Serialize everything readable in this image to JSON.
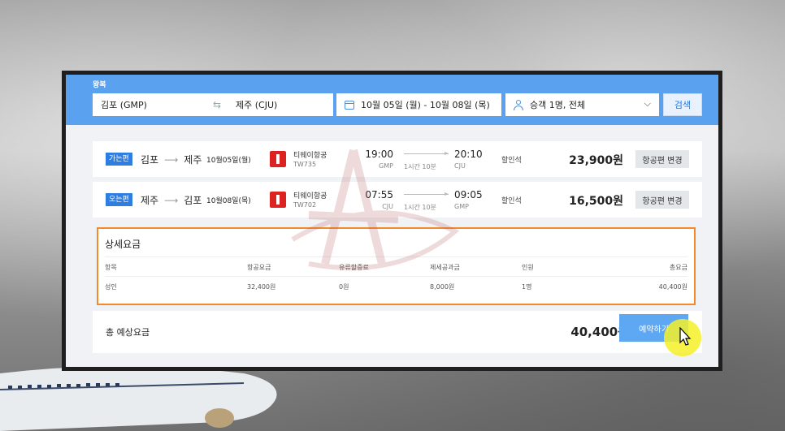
{
  "search": {
    "trip_type": "왕복",
    "origin": "김포 (GMP)",
    "destination": "제주 (CJU)",
    "dates": "10월 05일 (월) - 10월 08일 (목)",
    "passengers": "승객 1명, 전체",
    "search_button": "검색"
  },
  "flights": [
    {
      "badge": "가는편",
      "from": "김포",
      "to": "제주",
      "date": "10월05일(월)",
      "airline": "티웨이항공",
      "flight_no": "TW735",
      "dep_time": "19:00",
      "dep_code": "GMP",
      "duration": "1시간 10분",
      "arr_time": "20:10",
      "arr_code": "CJU",
      "fare_class": "할인석",
      "price": "23,900원",
      "change_label": "항공편 변경"
    },
    {
      "badge": "오는편",
      "from": "제주",
      "to": "김포",
      "date": "10월08일(목)",
      "airline": "티웨이항공",
      "flight_no": "TW702",
      "dep_time": "07:55",
      "dep_code": "CJU",
      "duration": "1시간 10분",
      "arr_time": "09:05",
      "arr_code": "GMP",
      "fare_class": "할인석",
      "price": "16,500원",
      "change_label": "항공편 변경"
    }
  ],
  "fare_detail": {
    "title": "상세요금",
    "headers": [
      "항목",
      "항공요금",
      "유류할증료",
      "제세공과금",
      "인원",
      "총요금"
    ],
    "rows": [
      [
        "성인",
        "32,400원",
        "0원",
        "8,000원",
        "1명",
        "40,400원"
      ]
    ]
  },
  "total": {
    "label": "총 예상요금",
    "amount": "40,400원",
    "reserve_button": "예약하기"
  },
  "colors": {
    "search_bar": "#5aa2f0",
    "badge": "#2e7de0",
    "detail_border": "#f08a2b",
    "reserve_button": "#5ea7f2",
    "cursor_highlight": "#f5f028"
  }
}
